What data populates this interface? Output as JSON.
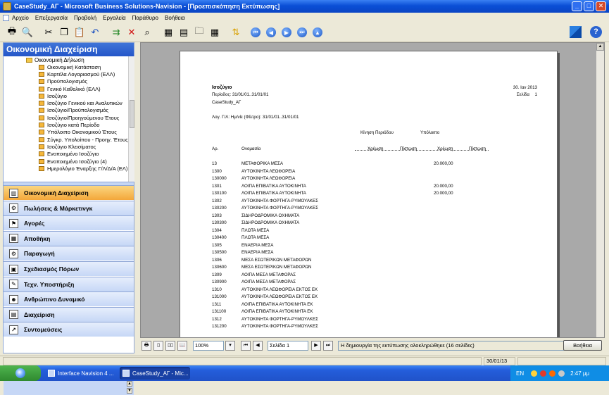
{
  "window": {
    "title": "CaseStudy_ΑΓ - Microsoft Business Solutions-Navision - [Προεπισκόπηση Εκτύπωσης]"
  },
  "menu": [
    "Αρχείο",
    "Επεξεργασία",
    "Προβολή",
    "Εργαλεία",
    "Παράθυρο",
    "Βοήθεια"
  ],
  "left_pane": {
    "header": "Οικονομική Διαχείριση",
    "tree_root": "Οικονομική Δήλωση",
    "tree_items": [
      "Οικονομική Κατάσταση",
      "Καρτέλα Λογαριασμού (ΕΛΛ)",
      "Προϋπολογισμός",
      "Γενικό Καθολικό (ΕΛΛ)",
      "Ισοζύγιο",
      "Ισοζύγιο Γενικού και Αναλυτικών",
      "Ισοζύγιο/Προϋπολογισμός",
      "Ισοζύγιο/Προηγούμενου Έτους",
      "Ισοζύγιο κατά Περίοδο",
      "Υπόλοιπο Οικονομικού Έτους",
      "Σύγκρ. Υπολοίπου - Προηγ. Έτους",
      "Ισοζύγιο Κλεισίματος",
      "Ενοποιημένο Ισοζύγιο",
      "Ενοποιημένο Ισοζύγιο (4)",
      "Ημερολόγιο Έναρξης Γ/Λ/Δ/Α (ΕΛ)"
    ],
    "nav_buttons": [
      {
        "label": "Οικονομική Διαχείριση",
        "icon": "chart-icon"
      },
      {
        "label": "Πωλήσεις & Μάρκετινγκ",
        "icon": "sales-icon"
      },
      {
        "label": "Αγορές",
        "icon": "purchase-icon"
      },
      {
        "label": "Αποθήκη",
        "icon": "warehouse-icon"
      },
      {
        "label": "Παραγωγή",
        "icon": "manufacturing-icon"
      },
      {
        "label": "Σχεδιασμός Πόρων",
        "icon": "resources-icon"
      },
      {
        "label": "Τεχν. Υποστήριξη",
        "icon": "service-icon"
      },
      {
        "label": "Ανθρώπινο Δυναμικό",
        "icon": "people-icon"
      },
      {
        "label": "Διαχείριση",
        "icon": "admin-icon"
      },
      {
        "label": "Συντομεύσεις",
        "icon": "shortcut-icon"
      }
    ]
  },
  "report": {
    "title": "Ισοζύγιο",
    "period": "Περίοδος: 31/01/01..31/01/01",
    "company": "CaseStudy_ΑΓ",
    "filter": "Λογ. Γ/Λ: Ημ/νίε (Φίλτρο): 31/01/01..31/01/01",
    "date": "30. Ιαν 2013",
    "page_label": "Σελίδα",
    "page_number": "1",
    "group_period": "Κίνηση Περιόδου",
    "group_balance": "Υπόλοιπο",
    "col_no": "Αρ.",
    "col_name": "Ονομασία",
    "col_debit1": "Χρέωση",
    "col_credit1": "Πίστωση",
    "col_debit2": "Χρέωση",
    "col_credit2": "Πίστωση",
    "rows": [
      {
        "no": "13",
        "name": "ΜΕΤΑΦΟΡΙΚΑ ΜΕΣΑ",
        "debit": "20.000,00"
      },
      {
        "no": "1300",
        "name": "ΑΥΤΟΚΙΝΗΤΑ ΛΕΩΦΟΡΕΙΑ",
        "debit": ""
      },
      {
        "no": "130000",
        "name": "ΑΥΤΟΚΙΝΗΤΑ ΛΕΩΦΟΡΕΙΑ",
        "debit": ""
      },
      {
        "no": "1301",
        "name": "ΛΟΙΠΑ ΕΠΙΒΑΤΙΚΑ ΑΥΤΟΚΙΝΗΤΑ",
        "debit": "20.000,00"
      },
      {
        "no": "130100",
        "name": "ΛΟΙΠΑ ΕΠΙΒΑΤΙΚΑ ΑΥΤΟΚΙΝΗΤΑ",
        "debit": "20.000,00"
      },
      {
        "no": "1302",
        "name": "ΑΥΤΟΚΙΝΗΤΑ ΦΟΡΤΗΓΑ-ΡΥΜΟΥΛΚΕΣ",
        "debit": ""
      },
      {
        "no": "130200",
        "name": "ΑΥΤΟΚΙΝΗΤΑ ΦΟΡΤΗΓΑ-ΡΥΜΟΥΛΚΕΣ",
        "debit": ""
      },
      {
        "no": "1303",
        "name": "ΣΙΔΗΡΟΔΡΟΜΙΚΑ ΟΧΗΜΑΤΑ",
        "debit": ""
      },
      {
        "no": "130300",
        "name": "ΣΙΔΗΡΟΔΡΟΜΙΚΑ ΟΧΗΜΑΤΑ",
        "debit": ""
      },
      {
        "no": "1304",
        "name": "ΠΛΩΤΑ ΜΕΣΑ",
        "debit": ""
      },
      {
        "no": "130400",
        "name": "ΠΛΩΤΑ ΜΕΣΑ",
        "debit": ""
      },
      {
        "no": "1305",
        "name": "ΕΝΑΕΡΙΑ ΜΕΣΑ",
        "debit": ""
      },
      {
        "no": "130500",
        "name": "ΕΝΑΕΡΙΑ ΜΕΣΑ",
        "debit": ""
      },
      {
        "no": "1306",
        "name": "ΜΕΣΑ ΕΣΩΤΕΡΙΚΩΝ ΜΕΤΑΦΟΡΩΝ",
        "debit": ""
      },
      {
        "no": "130600",
        "name": "ΜΕΣΑ ΕΣΩΤΕΡΙΚΩΝ ΜΕΤΑΦΟΡΩΝ",
        "debit": ""
      },
      {
        "no": "1309",
        "name": "ΛΟΙΠΑ ΜΕΣΑ ΜΕΤΑΦΟΡΑΣ",
        "debit": ""
      },
      {
        "no": "130900",
        "name": "ΛΟΙΠΑ ΜΕΣΑ ΜΕΤΑΦΟΡΑΣ",
        "debit": ""
      },
      {
        "no": "1310",
        "name": "ΑΥΤΟΚΙΝΗΤΑ ΛΕΩΦΟΡΕΙΑ ΕΚΤΟΣ ΕΚ",
        "debit": ""
      },
      {
        "no": "131000",
        "name": "ΑΥΤΟΚΙΝΗΤΑ ΛΕΩΦΟΡΕΙΑ ΕΚΤΟΣ ΕΚ",
        "debit": ""
      },
      {
        "no": "1311",
        "name": "ΛΟΙΠΑ ΕΠΙΒΑΤΙΚΑ ΑΥΤΟΚΙΝΗΤΑ ΕΚ",
        "debit": ""
      },
      {
        "no": "131100",
        "name": "ΛΟΙΠΑ ΕΠΙΒΑΤΙΚΑ ΑΥΤΟΚΙΝΗΤΑ ΕΚ",
        "debit": ""
      },
      {
        "no": "1312",
        "name": "ΑΥΤΟΚΙΝΗΤΑ ΦΟΡΤΗΓΑ-ΡΥΜΟΥΛΚΕΣ",
        "debit": ""
      },
      {
        "no": "131200",
        "name": "ΑΥΤΟΚΙΝΗΤΑ ΦΟΡΤΗΓΑ-ΡΥΜΟΥΛΚΕΣ",
        "debit": ""
      }
    ]
  },
  "preview_bar": {
    "zoom": "100%",
    "page_box": "Σελίδα 1",
    "status": "Η δημιουργία της εκτύπωσης ολοκληρώθηκε (16 σελίδες)",
    "help": "Βοήθεια"
  },
  "status_bar": {
    "date": "30/01/13"
  },
  "taskbar": {
    "tasks": [
      "Interface Navision 4 ...",
      "CaseStudy_ΑΓ - Mic..."
    ],
    "lang": "EN",
    "time": "2:47 μμ"
  }
}
